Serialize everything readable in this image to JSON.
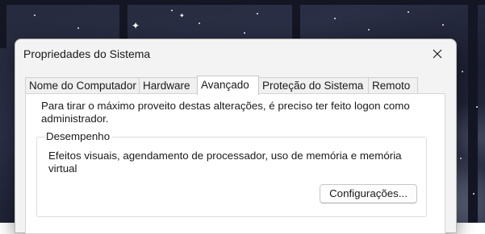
{
  "window": {
    "title": "Propriedades do Sistema",
    "close_icon": "close-icon"
  },
  "tabs": [
    {
      "label": "Nome do Computador",
      "active": false
    },
    {
      "label": "Hardware",
      "active": false
    },
    {
      "label": "Avançado",
      "active": true
    },
    {
      "label": "Proteção do Sistema",
      "active": false
    },
    {
      "label": "Remoto",
      "active": false
    }
  ],
  "advanced": {
    "intro": "Para tirar o máximo proveito destas alterações, é preciso ter feito logon como administrador.",
    "performance": {
      "legend": "Desempenho",
      "description": "Efeitos visuais, agendamento de processador, uso de memória e memória virtual",
      "settings_button": "Configurações..."
    }
  },
  "colors": {
    "window_bg": "#f3f3f3",
    "panel_bg": "#ffffff",
    "text": "#1a1a1a"
  }
}
